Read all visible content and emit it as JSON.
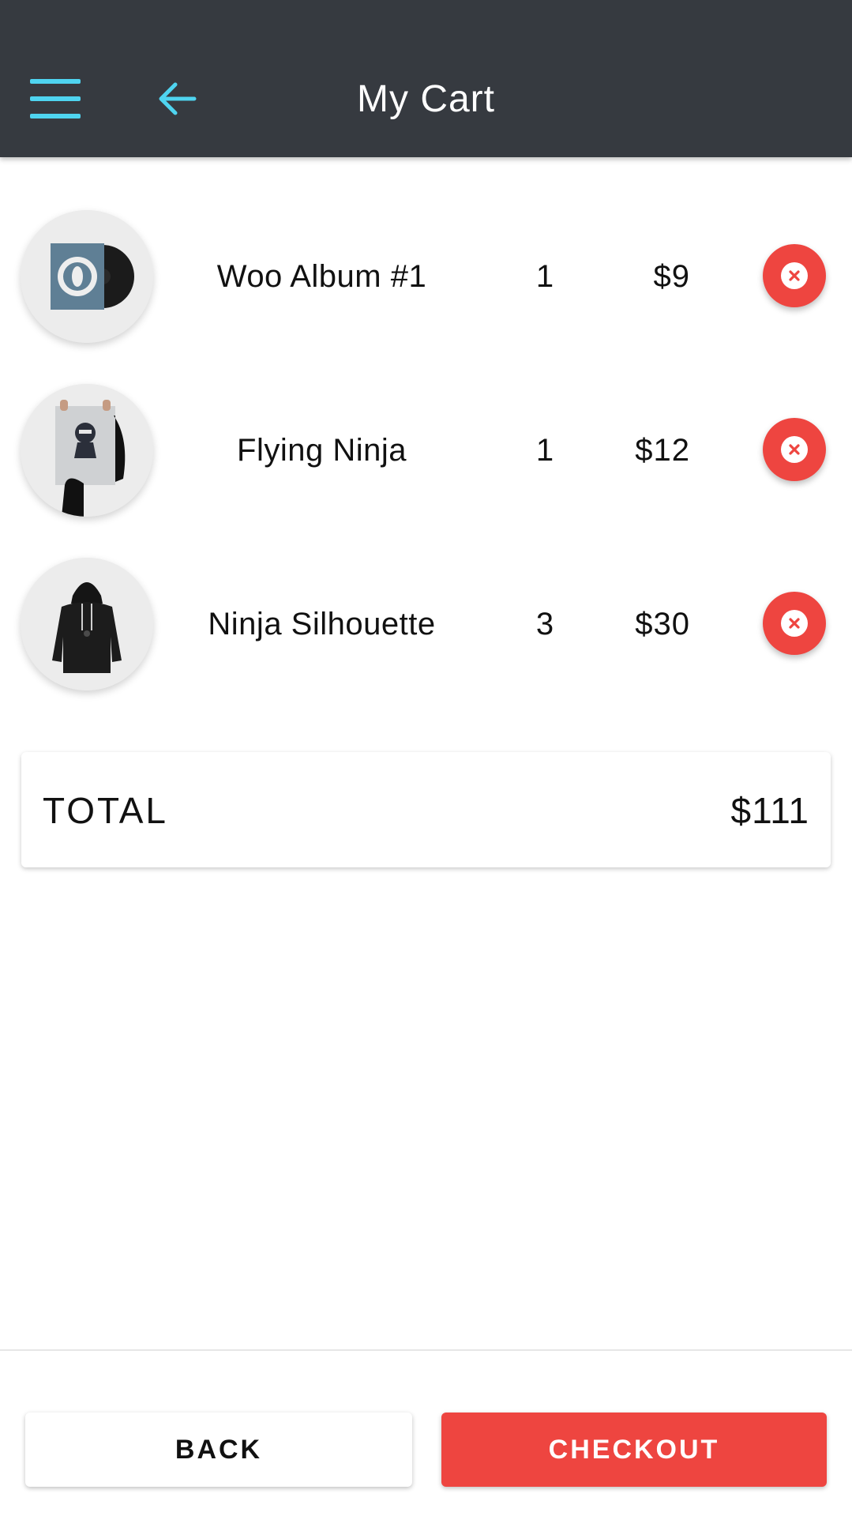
{
  "header": {
    "title": "My Cart",
    "menu_icon": "hamburger-menu-icon",
    "back_icon": "arrow-left-icon",
    "background": "#363a40",
    "accent": "#4fd4f0"
  },
  "cart": {
    "items": [
      {
        "name": "Woo Album #1",
        "qty": "1",
        "price": "$9",
        "thumb_icon": "vinyl-album-image"
      },
      {
        "name": "Flying Ninja",
        "qty": "1",
        "price": "$12",
        "thumb_icon": "ninja-poster-image"
      },
      {
        "name": "Ninja Silhouette",
        "qty": "3",
        "price": "$30",
        "thumb_icon": "black-hoodie-image"
      }
    ],
    "remove_icon": "close-circle-icon",
    "remove_color": "#ee4540"
  },
  "total": {
    "label": "TOTAL",
    "value": "$111"
  },
  "footer": {
    "back_label": "BACK",
    "checkout_label": "CHECKOUT",
    "checkout_color": "#ee4540"
  }
}
